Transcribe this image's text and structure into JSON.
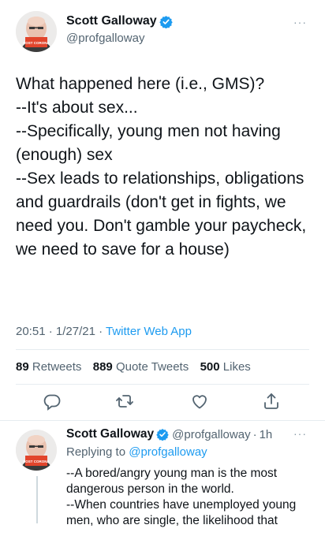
{
  "main_tweet": {
    "author_name": "Scott Galloway",
    "author_handle": "@profgalloway",
    "more_label": "···",
    "avatar_badge_text": "POST CORONA",
    "text": "What happened here (i.e., GMS)?\n--It's about sex...\n--Specifically, young men not having (enough) sex\n--Sex leads to relationships, obligations and guardrails (don't get in fights, we need you.  Don't gamble your paycheck, we need to save for a house)",
    "time": "20:51",
    "date": "1/27/21",
    "separator": "·",
    "source": "Twitter Web App",
    "retweets_count": "89",
    "retweets_label": "Retweets",
    "quotes_count": "889",
    "quotes_label": "Quote Tweets",
    "likes_count": "500",
    "likes_label": "Likes",
    "icons": [
      "reply-icon",
      "retweet-icon",
      "like-icon",
      "share-icon"
    ]
  },
  "reply_tweet": {
    "author_name": "Scott Galloway",
    "author_handle": "@profgalloway",
    "separator": "·",
    "age": "1h",
    "more_label": "···",
    "avatar_badge_text": "POST CORONA",
    "replying_prefix": "Replying to",
    "replying_to": "@profgalloway",
    "text": "--A bored/angry young man is the most dangerous person in the world.\n--When countries have unemployed young men, who are single, the likelihood that"
  },
  "colors": {
    "text": "#0f1419",
    "secondary": "#536471",
    "link": "#1d9bf0",
    "verified": "#1d9bf0",
    "divider": "#e6ecf0"
  }
}
